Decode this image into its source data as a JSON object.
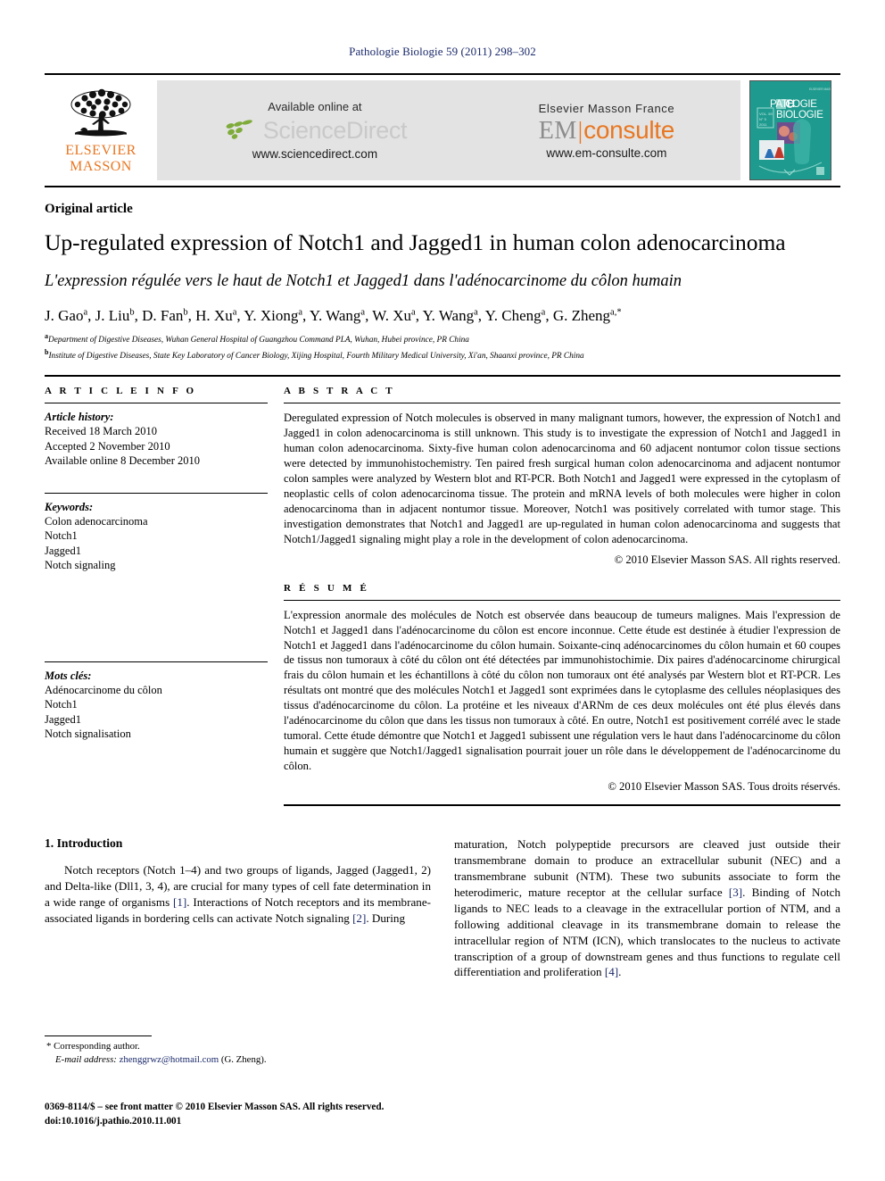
{
  "running_head": "Pathologie Biologie 59 (2011) 298–302",
  "masthead": {
    "publisher_logo_lines": [
      "ELSEVIER",
      "MASSON"
    ],
    "sciencedirect": {
      "available_text": "Available online at",
      "wordmark": "ScienceDirect",
      "url": "www.sciencedirect.com"
    },
    "emconsulte": {
      "title": "Elsevier Masson France",
      "wordmark_left": "EM",
      "wordmark_right": "consulte",
      "url": "www.em-consulte.com"
    },
    "cover": {
      "line1": "PATHOLOGIE",
      "line2": "BIOLOGIE",
      "color": "#1f9a8e"
    }
  },
  "article": {
    "type": "Original article",
    "title_en": "Up-regulated expression of Notch1 and Jagged1 in human colon adenocarcinoma",
    "title_fr": "L'expression régulée vers le haut de Notch1 et Jagged1 dans l'adénocarcinome du côlon humain",
    "authors": [
      {
        "name": "J. Gao",
        "sup": "a"
      },
      {
        "name": "J. Liu",
        "sup": "b"
      },
      {
        "name": "D. Fan",
        "sup": "b"
      },
      {
        "name": "H. Xu",
        "sup": "a"
      },
      {
        "name": "Y. Xiong",
        "sup": "a"
      },
      {
        "name": "Y. Wang",
        "sup": "a"
      },
      {
        "name": "W. Xu",
        "sup": "a"
      },
      {
        "name": "Y. Wang",
        "sup": "a"
      },
      {
        "name": "Y. Cheng",
        "sup": "a"
      },
      {
        "name": "G. Zheng",
        "sup": "a,*"
      }
    ],
    "affiliations": [
      {
        "marker": "a",
        "text": "Department of Digestive Diseases, Wuhan General Hospital of Guangzhou Command PLA, Wuhan, Hubei province, PR China"
      },
      {
        "marker": "b",
        "text": "Institute of Digestive Diseases, State Key Laboratory of Cancer Biology, Xijing Hospital, Fourth Military Medical University, Xi'an, Shaanxi province, PR China"
      }
    ]
  },
  "article_info": {
    "heading": "A R T I C L E   I N F O",
    "history_label": "Article history:",
    "history": [
      "Received 18 March 2010",
      "Accepted 2 November 2010",
      "Available online 8 December 2010"
    ],
    "keywords_label": "Keywords:",
    "keywords": [
      "Colon adenocarcinoma",
      "Notch1",
      "Jagged1",
      "Notch signaling"
    ],
    "motscles_label": "Mots clés:",
    "motscles": [
      "Adénocarcinome du côlon",
      "Notch1",
      "Jagged1",
      "Notch signalisation"
    ]
  },
  "abstract": {
    "heading": "A B S T R A C T",
    "text": "Deregulated expression of Notch molecules is observed in many malignant tumors, however, the expression of Notch1 and Jagged1 in colon adenocarcinoma is still unknown. This study is to investigate the expression of Notch1 and Jagged1 in human colon adenocarcinoma. Sixty-five human colon adenocarcinoma and 60 adjacent nontumor colon tissue sections were detected by immunohistochemistry. Ten paired fresh surgical human colon adenocarcinoma and adjacent nontumor colon samples were analyzed by Western blot and RT-PCR. Both Notch1 and Jagged1 were expressed in the cytoplasm of neoplastic cells of colon adenocarcinoma tissue. The protein and mRNA levels of both molecules were higher in colon adenocarcinoma than in adjacent nontumor tissue. Moreover, Notch1 was positively correlated with tumor stage. This investigation demonstrates that Notch1 and Jagged1 are up-regulated in human colon adenocarcinoma and suggests that Notch1/Jagged1 signaling might play a role in the development of colon adenocarcinoma.",
    "copyright": "© 2010 Elsevier Masson SAS. All rights reserved."
  },
  "resume": {
    "heading": "R É S U M É",
    "text": "L'expression anormale des molécules de Notch est observée dans beaucoup de tumeurs malignes. Mais l'expression de Notch1 et Jagged1 dans l'adénocarcinome du côlon est encore inconnue. Cette étude est destinée à étudier l'expression de Notch1 et Jagged1 dans l'adénocarcinome du côlon humain. Soixante-cinq adénocarcinomes du côlon humain et 60 coupes de tissus non tumoraux à côté du côlon ont été détectées par immunohistochimie. Dix paires d'adénocarcinome chirurgical frais du côlon humain et les échantillons à côté du côlon non tumoraux ont été analysés par Western blot et RT-PCR. Les résultats ont montré que des molécules Notch1 et Jagged1 sont exprimées dans le cytoplasme des cellules néoplasiques des tissus d'adénocarcinome du côlon. La protéine et les niveaux d'ARNm de ces deux molécules ont été plus élevés dans l'adénocarcinome du côlon que dans les tissus non tumoraux à côté. En outre, Notch1 est positivement corrélé avec le stade tumoral. Cette étude démontre que Notch1 et Jagged1 subissent une régulation vers le haut dans l'adénocarcinome du côlon humain et suggère que Notch1/Jagged1 signalisation pourrait jouer un rôle dans le développement de l'adénocarcinome du côlon.",
    "copyright": "© 2010 Elsevier Masson SAS. Tous droits réservés."
  },
  "introduction": {
    "heading": "1. Introduction",
    "col_left_part1": "Notch receptors (Notch 1–4) and two groups of ligands, Jagged (Jagged1, 2) and Delta-like (Dll1, 3, 4), are crucial for many types of cell fate determination in a wide range of organisms ",
    "ref1": "[1]",
    "col_left_part2": ". Interactions of Notch receptors and its membrane-associated ligands in bordering cells can activate Notch signaling ",
    "ref2": "[2]",
    "col_left_part3": ". During",
    "col_right_part1": "maturation, Notch polypeptide precursors are cleaved just outside their transmembrane domain to produce an extracellular subunit (NEC) and a transmembrane subunit (NTM). These two subunits associate to form the heterodimeric, mature receptor at the cellular surface ",
    "ref3": "[3]",
    "col_right_part2": ". Binding of Notch ligands to NEC leads to a cleavage in the extracellular portion of NTM, and a following additional cleavage in its transmembrane domain to release the intracellular region of NTM (ICN), which translocates to the nucleus to activate transcription of a group of downstream genes and thus functions to regulate cell differentiation and proliferation ",
    "ref4": "[4]",
    "col_right_part3": "."
  },
  "footnote": {
    "corresponding_marker": "*",
    "corresponding_label": "Corresponding author.",
    "email_label": "E-mail address:",
    "email": "zhenggrwz@hotmail.com",
    "email_suffix": "(G. Zheng)."
  },
  "imprint": {
    "line1": "0369-8114/$ – see front matter © 2010 Elsevier Masson SAS. All rights reserved.",
    "doi": "doi:10.1016/j.pathio.2010.11.001"
  }
}
